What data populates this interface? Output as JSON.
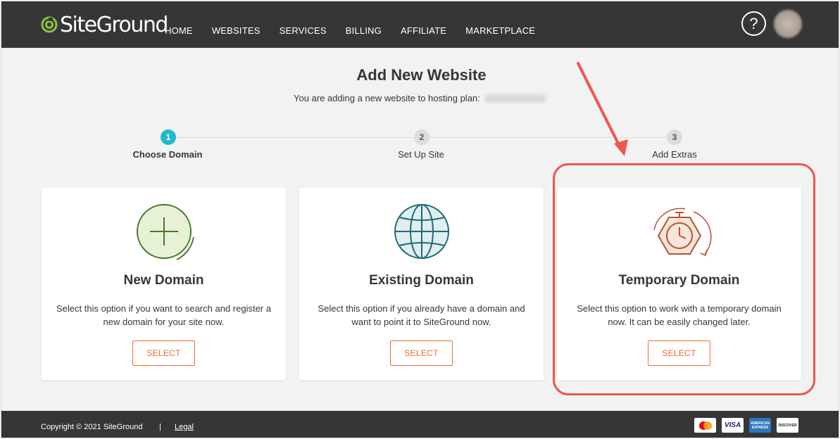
{
  "header": {
    "logo_text": "SiteGround",
    "nav": [
      "HOME",
      "WEBSITES",
      "SERVICES",
      "BILLING",
      "AFFILIATE",
      "MARKETPLACE"
    ],
    "help_label": "?"
  },
  "page": {
    "title": "Add New Website",
    "subtitle": "You are adding a new website to hosting plan:"
  },
  "steps": [
    {
      "number": "1",
      "label": "Choose Domain",
      "active": true
    },
    {
      "number": "2",
      "label": "Set Up Site",
      "active": false
    },
    {
      "number": "3",
      "label": "Add Extras",
      "active": false
    }
  ],
  "cards": [
    {
      "icon": "plus-circle-icon",
      "title": "New Domain",
      "desc": "Select this option if you want to search and register a new domain for your site now.",
      "button": "SELECT"
    },
    {
      "icon": "globe-icon",
      "title": "Existing Domain",
      "desc": "Select this option if you already have a domain and want to point it to SiteGround now.",
      "button": "SELECT"
    },
    {
      "icon": "clock-hexagon-icon",
      "title": "Temporary Domain",
      "desc": "Select this option to work with a temporary domain now. It can be easily changed later.",
      "button": "SELECT"
    }
  ],
  "footer": {
    "copyright": "Copyright © 2021 SiteGround",
    "separator": "|",
    "legal": "Legal",
    "payments": [
      "mastercard",
      "VISA",
      "AMERICAN EXPRESS",
      "DISCOVER"
    ]
  },
  "colors": {
    "header_bg": "#363636",
    "accent_orange": "#f26c2b",
    "step_active": "#22b8cf",
    "annotation_red": "#ee5450",
    "new_domain_green": "#4a7a2a",
    "existing_domain_teal": "#1f6b78",
    "temporary_domain_brown": "#b5532e"
  }
}
